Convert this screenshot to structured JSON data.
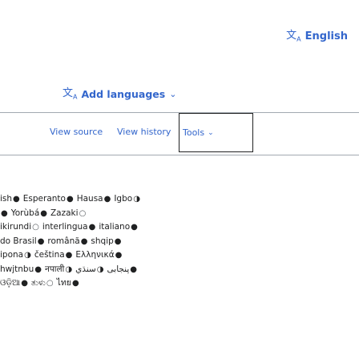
{
  "header": {
    "language_button_label": "English",
    "language_icon": "translate-icon"
  },
  "add_languages": {
    "label": "Add languages",
    "icon": "translate-icon"
  },
  "tabs": [
    {
      "label": "View source"
    },
    {
      "label": "View history"
    },
    {
      "label": "Tools"
    }
  ],
  "language_lines": [
    [
      {
        "text": "ish",
        "dot": "filled"
      },
      {
        "text": "Esperanto",
        "dot": "filled"
      },
      {
        "text": "Hausa",
        "dot": "filled"
      },
      {
        "text": "Igbo",
        "dot": "partial"
      }
    ],
    [
      {
        "text": "",
        "dot": "filled"
      },
      {
        "text": "Yorùbá",
        "dot": "filled"
      },
      {
        "text": "Zazaki",
        "dot": "hollow"
      }
    ],
    [
      {
        "text": "ikirundi",
        "dot": "hollow"
      },
      {
        "text": "interlingua",
        "dot": "filled"
      },
      {
        "text": "italiano",
        "dot": "filled"
      }
    ],
    [
      {
        "text": "do Brasil",
        "dot": "filled"
      },
      {
        "text": "română",
        "dot": "filled"
      },
      {
        "text": "shqip",
        "dot": "filled"
      }
    ],
    [
      {
        "text": "ipona",
        "dot": "partial"
      },
      {
        "text": "čeština",
        "dot": "filled"
      },
      {
        "text": "Ελληνικά",
        "dot": "filled"
      }
    ],
    [
      {
        "text": "hwjtnbu",
        "dot": "filled"
      },
      {
        "text": "नपाली",
        "dot": "partial"
      },
      {
        "text": "پنجابی",
        "dot": "partial"
      },
      {
        "text": "سنڌي",
        "dot": "filled"
      }
    ],
    [
      {
        "text": "ଓଡ଼ିଆ",
        "dot": "filled"
      },
      {
        "text": "ತುಳು",
        "dot": "hollow"
      },
      {
        "text": "ไทย",
        "dot": "filled"
      }
    ]
  ]
}
